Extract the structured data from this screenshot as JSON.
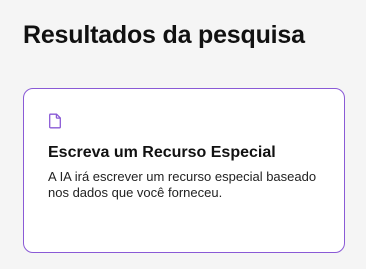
{
  "page": {
    "title": "Resultados da pesquisa"
  },
  "result_card": {
    "icon": "document-icon",
    "title": "Escreva um Recurso Especial",
    "description": "A IA irá escrever um recurso especial baseado nos dados que você forneceu.",
    "accent_color": "#8a5ad6"
  }
}
